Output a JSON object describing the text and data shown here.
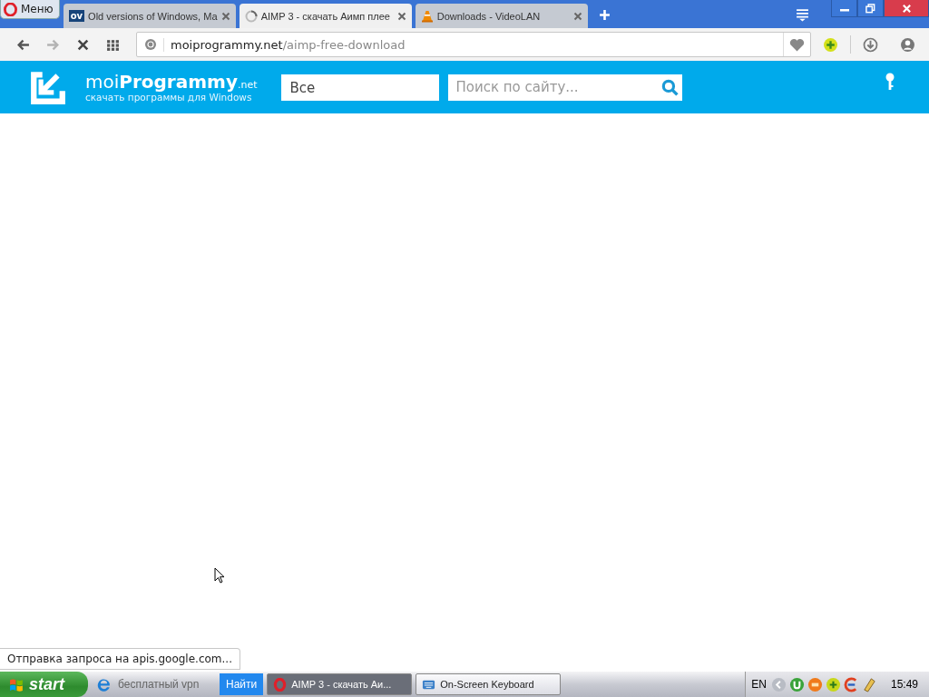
{
  "browser": {
    "menu_label": "Меню",
    "tabs": [
      {
        "kind": "badge",
        "icon_text": "ov",
        "label": "Old versions of Windows, Ma",
        "selected": false
      },
      {
        "kind": "spinner",
        "label": "AIMP 3 - скачать Аимп плее",
        "selected": true
      },
      {
        "kind": "cone",
        "label": "Downloads - VideoLAN",
        "selected": false
      }
    ],
    "nav_buttons": [
      {
        "kind": "back",
        "disabled": false
      },
      {
        "kind": "forward",
        "disabled": true
      },
      {
        "kind": "stop",
        "disabled": false
      },
      {
        "kind": "grid",
        "disabled": false
      }
    ],
    "address": {
      "host": "moiprogrammy.net",
      "path": "/aimp-free-download"
    },
    "status_text": "Отправка запроса на apis.google.com..."
  },
  "site": {
    "logo_name": "moi**Programmy**",
    "logo_tld": ".net",
    "tagline": "скачать программы для Windows",
    "category": "Все",
    "search": {
      "placeholder": "Поиск по сайту..."
    }
  },
  "taskbar": {
    "start_label": "start",
    "quick_search": {
      "value": "бесплатный vpn"
    },
    "find_button": "Найти",
    "tasks": [
      {
        "kind": "opera",
        "label": "AIMP 3 - скачать Аи...",
        "selected": true
      },
      {
        "kind": "keyboard",
        "label": "On-Screen Keyboard",
        "selected": false
      }
    ],
    "language": "EN",
    "clock": "15:49"
  }
}
